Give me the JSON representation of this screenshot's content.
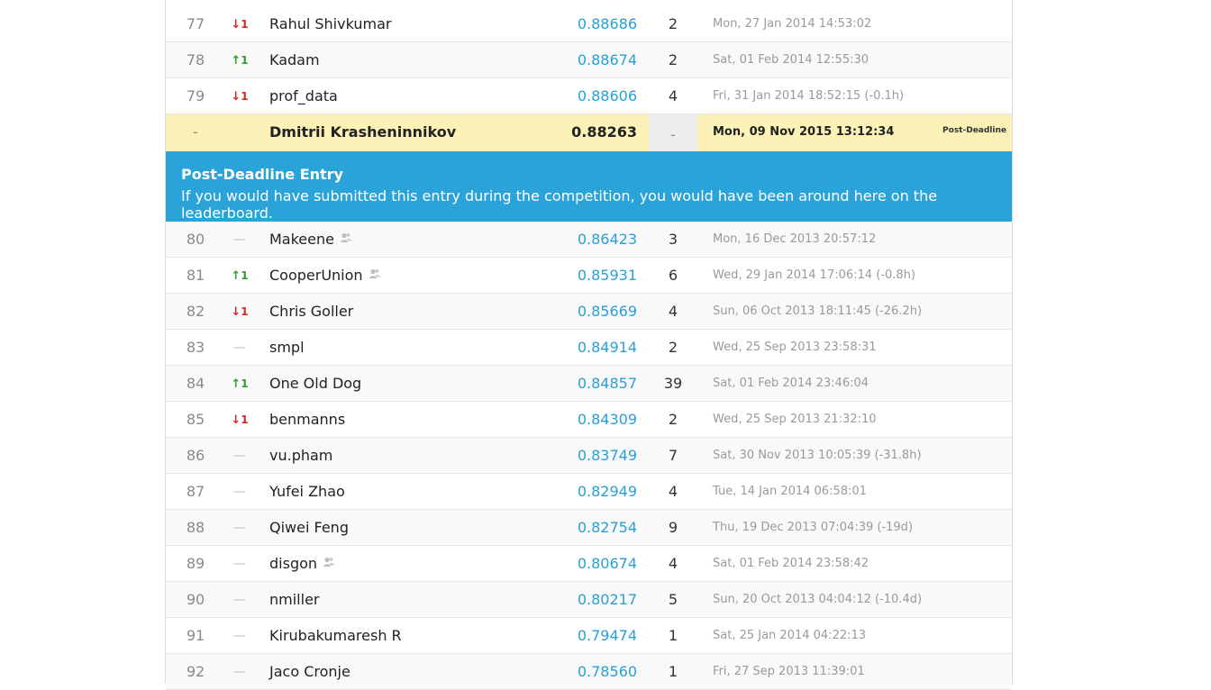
{
  "rows_top": [
    {
      "rank": "77",
      "dir": "down",
      "delta": "1",
      "name": "Rahul Shivkumar",
      "team": false,
      "score": "0.88686",
      "entries": "2",
      "time": "Mon, 27 Jan 2014 14:53:02"
    },
    {
      "rank": "78",
      "dir": "up",
      "delta": "1",
      "name": "Kadam",
      "team": false,
      "score": "0.88674",
      "entries": "2",
      "time": "Sat, 01 Feb 2014 12:55:30"
    },
    {
      "rank": "79",
      "dir": "down",
      "delta": "1",
      "name": "prof_data",
      "team": false,
      "score": "0.88606",
      "entries": "4",
      "time": "Fri, 31 Jan 2014 18:52:15 (-0.1h)"
    }
  ],
  "post_deadline_row": {
    "rank": "-",
    "name": "Dmitrii Krasheninnikov",
    "score": "0.88263",
    "entries": "-",
    "time": "Mon, 09 Nov 2015 13:12:34",
    "tag": "Post-Deadline"
  },
  "banner": {
    "title": "Post-Deadline Entry",
    "text": "If you would have submitted this entry during the competition, you would have been around here on the leaderboard."
  },
  "rows_bottom": [
    {
      "rank": "80",
      "dir": "none",
      "delta": "—",
      "name": "Makeene",
      "team": true,
      "score": "0.86423",
      "entries": "3",
      "time": "Mon, 16 Dec 2013 20:57:12"
    },
    {
      "rank": "81",
      "dir": "up",
      "delta": "1",
      "name": "CooperUnion",
      "team": true,
      "score": "0.85931",
      "entries": "6",
      "time": "Wed, 29 Jan 2014 17:06:14 (-0.8h)"
    },
    {
      "rank": "82",
      "dir": "down",
      "delta": "1",
      "name": "Chris Goller",
      "team": false,
      "score": "0.85669",
      "entries": "4",
      "time": "Sun, 06 Oct 2013 18:11:45 (-26.2h)"
    },
    {
      "rank": "83",
      "dir": "none",
      "delta": "—",
      "name": "smpl",
      "team": false,
      "score": "0.84914",
      "entries": "2",
      "time": "Wed, 25 Sep 2013 23:58:31"
    },
    {
      "rank": "84",
      "dir": "up",
      "delta": "1",
      "name": "One Old Dog",
      "team": false,
      "score": "0.84857",
      "entries": "39",
      "time": "Sat, 01 Feb 2014 23:46:04"
    },
    {
      "rank": "85",
      "dir": "down",
      "delta": "1",
      "name": "benmanns",
      "team": false,
      "score": "0.84309",
      "entries": "2",
      "time": "Wed, 25 Sep 2013 21:32:10"
    },
    {
      "rank": "86",
      "dir": "none",
      "delta": "—",
      "name": "vu.pham",
      "team": false,
      "score": "0.83749",
      "entries": "7",
      "time": "Sat, 30 Nov 2013 10:05:39 (-31.8h)"
    },
    {
      "rank": "87",
      "dir": "none",
      "delta": "—",
      "name": "Yufei Zhao",
      "team": false,
      "score": "0.82949",
      "entries": "4",
      "time": "Tue, 14 Jan 2014 06:58:01"
    },
    {
      "rank": "88",
      "dir": "none",
      "delta": "—",
      "name": "Qiwei Feng",
      "team": false,
      "score": "0.82754",
      "entries": "9",
      "time": "Thu, 19 Dec 2013 07:04:39 (-19d)"
    },
    {
      "rank": "89",
      "dir": "none",
      "delta": "—",
      "name": "disgon",
      "team": true,
      "score": "0.80674",
      "entries": "4",
      "time": "Sat, 01 Feb 2014 23:58:42"
    },
    {
      "rank": "90",
      "dir": "none",
      "delta": "—",
      "name": "nmiller",
      "team": false,
      "score": "0.80217",
      "entries": "5",
      "time": "Sun, 20 Oct 2013 04:04:12 (-10.4d)"
    },
    {
      "rank": "91",
      "dir": "none",
      "delta": "—",
      "name": "Kirubakumaresh R",
      "team": false,
      "score": "0.79474",
      "entries": "1",
      "time": "Sat, 25 Jan 2014 04:22:13"
    },
    {
      "rank": "92",
      "dir": "none",
      "delta": "—",
      "name": "Jaco Cronje",
      "team": false,
      "score": "0.78560",
      "entries": "1",
      "time": "Fri, 27 Sep 2013 11:39:01"
    }
  ],
  "colors": {
    "score_link": "#2aa3d8",
    "up": "#2ca02c",
    "down": "#d62728",
    "highlight_bg": "#fcf1b6",
    "banner_bg": "#2aa3d8"
  },
  "icons": {
    "up": "arrow-up-icon",
    "down": "arrow-down-icon",
    "team": "team-icon"
  }
}
